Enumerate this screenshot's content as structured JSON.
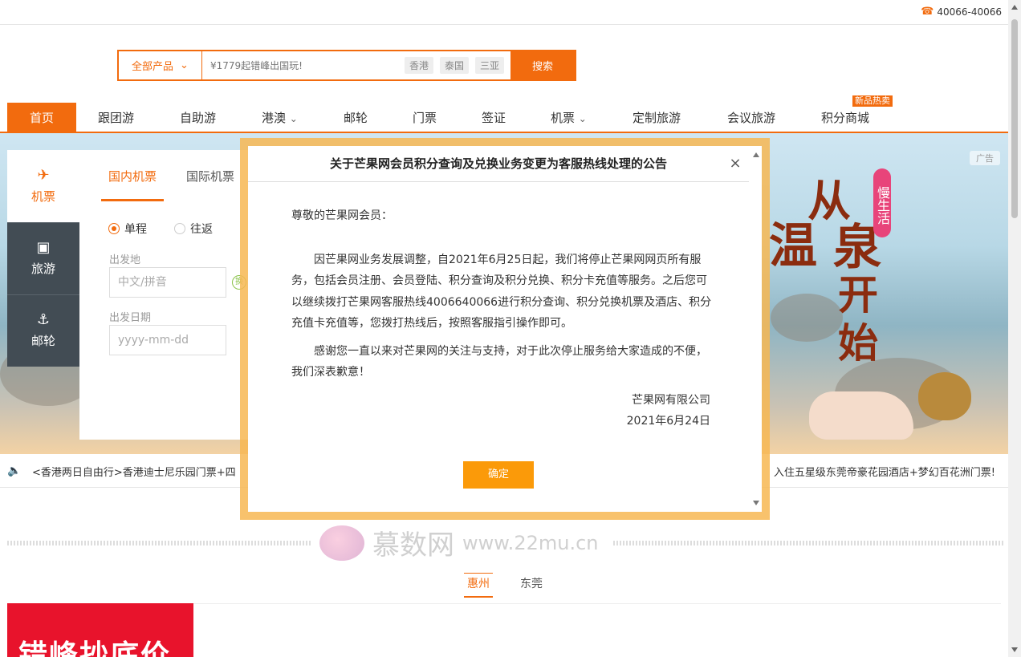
{
  "topbar": {
    "phone_icon": "phone-icon",
    "phone": "40066-40066"
  },
  "search": {
    "category": "全部产品",
    "placeholder": "¥1779起错峰出国玩!",
    "tags": [
      "香港",
      "泰国",
      "三亚"
    ],
    "button": "搜索"
  },
  "nav": {
    "items": [
      "首页",
      "跟团游",
      "自助游",
      "港澳",
      "邮轮",
      "门票",
      "签证",
      "机票",
      "定制旅游",
      "会议旅游",
      "积分商城"
    ],
    "badge": "新品热卖"
  },
  "banner": {
    "ad_label": "广告",
    "promo_big": [
      "从",
      "温",
      "泉",
      "开",
      "始"
    ],
    "promo_tag": "慢生活"
  },
  "sidetabs": [
    {
      "icon": "plane-icon",
      "label": "机票"
    },
    {
      "icon": "luggage-icon",
      "label": "旅游"
    },
    {
      "icon": "anchor-icon",
      "label": "邮轮"
    }
  ],
  "booking": {
    "tabs": [
      "国内机票",
      "国际机票"
    ],
    "trip_types": [
      "单程",
      "往返"
    ],
    "from_label": "出发地",
    "from_placeholder": "中文/拼音",
    "swap_label": "换",
    "date_label": "出发日期",
    "date_placeholder": "yyyy-mm-dd"
  },
  "ticker": {
    "left": "<香港两日自由行>香港迪士尼乐园门票+四",
    "right": "入住五星级东莞帝豪花园酒店+梦幻百花洲门票!"
  },
  "watermark": {
    "text": "慕数网",
    "url": "www.22mu.cn"
  },
  "city_tabs": [
    "惠州",
    "东莞"
  ],
  "redbox": {
    "text": "错峰抄底价"
  },
  "modal": {
    "title": "关于芒果网会员积分查询及兑换业务变更为客服热线处理的公告",
    "close": "×",
    "greeting": "尊敬的芒果网会员：",
    "para1": "因芒果网业务发展调整，自2021年6月25日起，我们将停止芒果网网页所有服务，包括会员注册、会员登陆、积分查询及积分兑换、积分卡充值等服务。之后您可以继续拨打芒果网客服热线4006640066进行积分查询、积分兑换机票及酒店、积分充值卡充值等，您拨打热线后，按照客服指引操作即可。",
    "para2": "感谢您一直以来对芒果网的关注与支持，对于此次停止服务给大家造成的不便，我们深表歉意！",
    "company": "芒果网有限公司",
    "date": "2021年6月24日",
    "ok": "确定"
  }
}
